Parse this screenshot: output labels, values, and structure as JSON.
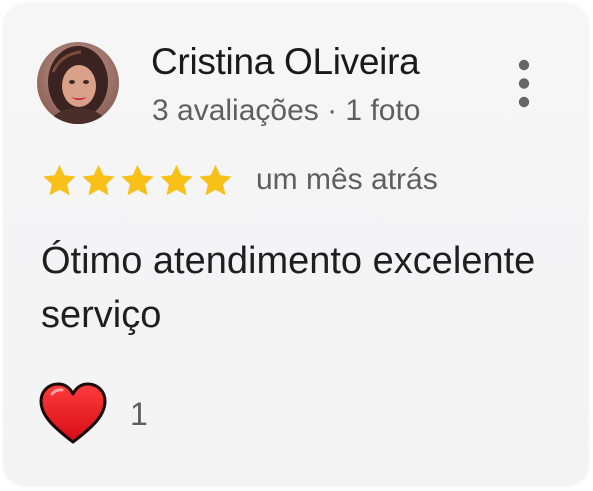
{
  "review": {
    "author_name": "Cristina OLiveira",
    "author_meta": "3 avaliações · 1 foto",
    "rating": 5,
    "rating_max": 5,
    "time_ago": "um mês atrás",
    "text": "Ótimo atendimento excelente serviço",
    "likes": "1"
  },
  "icons": {
    "menu": "more-vert-icon",
    "star": "star-icon",
    "reaction": "heart-icon"
  },
  "colors": {
    "star": "#f7c11a",
    "heart": "#e8141c",
    "name": "#1a1a1a",
    "secondary": "#5f5f5f"
  }
}
